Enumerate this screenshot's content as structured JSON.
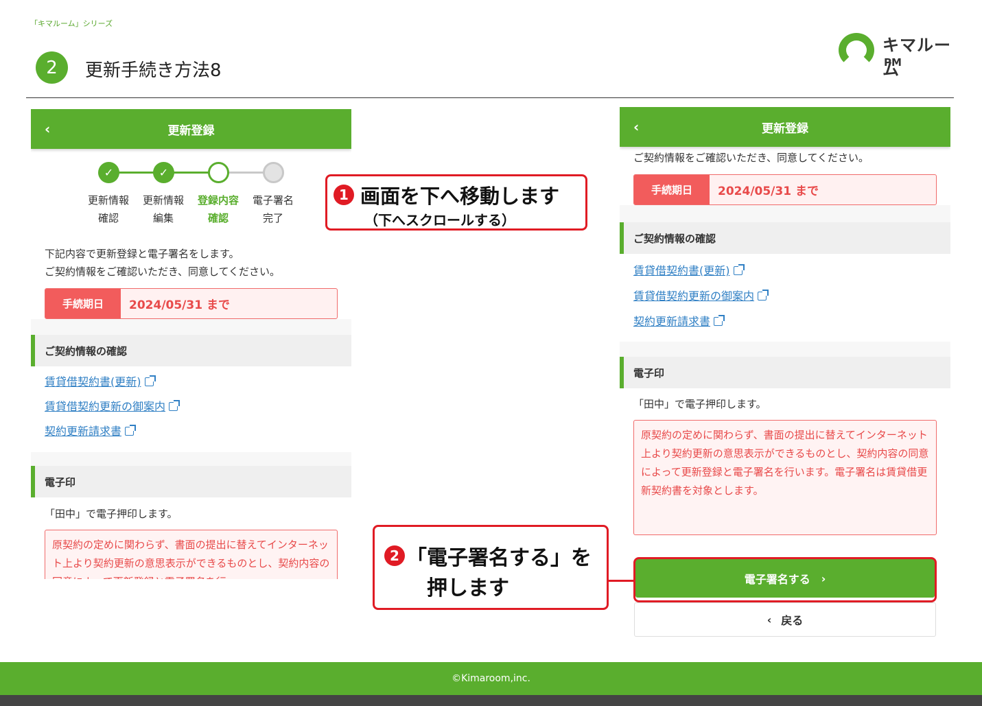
{
  "header": {
    "series": "「キマルーム」シリーズ",
    "step_number": "2",
    "title": "更新手続き方法8",
    "logo_name": "キマルーム",
    "logo_sub": "PM"
  },
  "left_panel": {
    "appbar_title": "更新登録",
    "back_glyph": "‹",
    "stepper": [
      {
        "line1": "更新情報",
        "line2": "確認",
        "state": "done"
      },
      {
        "line1": "更新情報",
        "line2": "編集",
        "state": "done"
      },
      {
        "line1": "登録内容",
        "line2": "確認",
        "state": "current"
      },
      {
        "line1": "電子署名",
        "line2": "完了",
        "state": "todo"
      }
    ],
    "intro_line1": "下記内容で更新登録と電子署名をします。",
    "intro_line2": "ご契約情報をご確認いただき、同意してください。",
    "deadline_label": "手続期日",
    "deadline_value": "2024/05/31 まで",
    "contract_section": "ご契約情報の確認",
    "links": [
      "賃貸借契約書(更新)",
      "賃貸借契約更新の御案内",
      "契約更新請求書"
    ],
    "seal_section": "電子印",
    "seal_text": "「田中」で電子押印します。",
    "notice": "原契約の定めに関わらず、書面の提出に替えてインターネット上より契約更新の意思表示ができるものとし、契約内容の同意によって更新登録と電子署名を行"
  },
  "right_panel": {
    "appbar_title": "更新登録",
    "back_glyph": "‹",
    "intro": "ご契約情報をご確認いただき、同意してください。",
    "deadline_label": "手続期日",
    "deadline_value": "2024/05/31 まで",
    "contract_section": "ご契約情報の確認",
    "links": [
      "賃貸借契約書(更新)",
      "賃貸借契約更新の御案内",
      "契約更新請求書"
    ],
    "seal_section": "電子印",
    "seal_text": "「田中」で電子押印します。",
    "notice": "原契約の定めに関わらず、書面の提出に替えてインターネット上より契約更新の意思表示ができるものとし、契約内容の同意によって更新登録と電子署名を行います。電子署名は賃貸借更新契約書を対象とします。",
    "sign_button": "電子署名する",
    "sign_arrow": "›",
    "back_button": "戻る",
    "back_arrow": "‹"
  },
  "callouts": {
    "one_number": "1",
    "one_main": "画面を下へ移動します",
    "one_sub": "（下へスクロールする）",
    "two_number": "2",
    "two_line1": "「電子署名する」を",
    "two_line2": "押します"
  },
  "footer": {
    "copyright": "©Kimaroom,inc."
  },
  "colors": {
    "brand_green": "#5aae2e",
    "alert_red": "#e84a4a",
    "callout_red": "#e01b24",
    "link_blue": "#2f7fc4"
  }
}
